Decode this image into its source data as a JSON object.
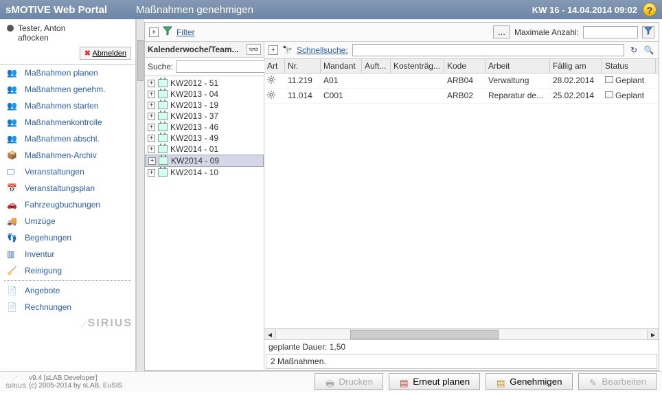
{
  "header": {
    "brand": "sMOTIVE Web Portal",
    "title": "Maßnahmen genehmigen",
    "datetime": "KW 16 - 14.04.2014 09:02"
  },
  "user": {
    "name": "Tester, Anton",
    "sub": "aflocken",
    "logout_x": "✖",
    "logout_label": "Abmelden"
  },
  "nav": [
    {
      "label": "Maßnahmen planen"
    },
    {
      "label": "Maßnahmen genehm."
    },
    {
      "label": "Maßnahmen starten"
    },
    {
      "label": "Maßnahmenkontrolle"
    },
    {
      "label": "Maßnahmen abschl."
    },
    {
      "label": "Maßnahmen-Archiv"
    },
    {
      "label": "Veranstaltungen"
    },
    {
      "label": "Veranstaltungsplan"
    },
    {
      "label": "Fahrzeugbuchungen"
    },
    {
      "label": "Umzüge"
    },
    {
      "label": "Begehungen"
    },
    {
      "label": "Inventur"
    },
    {
      "label": "Reinigung"
    },
    {
      "label": "Angebote",
      "sep": true
    },
    {
      "label": "Rechnungen"
    }
  ],
  "filter": {
    "label": "Filter",
    "max_label": "Maximale Anzahl:"
  },
  "tree": {
    "header": "Kalenderwoche/Team...",
    "search_label": "Suche:",
    "items": [
      {
        "label": "KW2012 - 51"
      },
      {
        "label": "KW2013 - 04"
      },
      {
        "label": "KW2013 - 19"
      },
      {
        "label": "KW2013 - 37"
      },
      {
        "label": "KW2013 - 46"
      },
      {
        "label": "KW2013 - 49"
      },
      {
        "label": "KW2014 - 01"
      },
      {
        "label": "KW2014 - 09",
        "selected": true
      },
      {
        "label": "KW2014 - 10"
      }
    ]
  },
  "quicksearch": {
    "label": "Schnellsuche:"
  },
  "grid": {
    "columns": [
      "Art",
      "Nr.",
      "Mandant",
      "Auft...",
      "Kostenträg...",
      "Kode",
      "Arbeit",
      "Fällig am",
      "Status"
    ],
    "rows": [
      {
        "art": "gear",
        "nr": "11.219",
        "mandant": "A01",
        "auft": "",
        "kost": "",
        "kode": "ARB04",
        "arbeit": "Verwaltung",
        "fallig": "28.02.2014",
        "status": "Geplant"
      },
      {
        "art": "gear",
        "nr": "11.014",
        "mandant": "C001",
        "auft": "",
        "kost": "",
        "kode": "ARB02",
        "arbeit": "Reparatur de...",
        "fallig": "25.02.2014",
        "status": "Geplant"
      }
    ]
  },
  "info": {
    "duration": "geplante Dauer: 1,50",
    "count": "2 Maßnahmen."
  },
  "footer": {
    "version": "v9.4 [sLAB Developer]",
    "copyright": "(c) 2005-2014 by sLAB, EuSIS",
    "btn_print": "Drucken",
    "btn_replan": "Erneut planen",
    "btn_approve": "Genehmigen",
    "btn_edit": "Bearbeiten"
  },
  "watermark": "SIRIUS"
}
